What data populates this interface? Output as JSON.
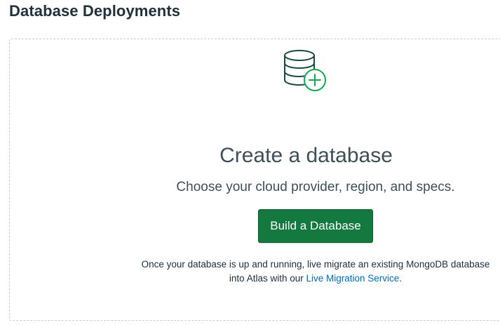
{
  "header": {
    "title": "Database Deployments"
  },
  "empty_state": {
    "icon": "database-plus-icon",
    "headline": "Create a database",
    "subtitle": "Choose your cloud provider, region, and specs.",
    "build_button_label": "Build a Database",
    "note_line1": "Once your database is up and running, live migrate an existing MongoDB database",
    "note_line2_prefix": "into Atlas with our ",
    "migration_link_label": "Live Migration Service",
    "note_line2_suffix": "."
  },
  "colors": {
    "primary_button": "#13793f",
    "icon_dark": "#1a4a44",
    "icon_accent": "#13aa52",
    "link": "#006cbc"
  }
}
